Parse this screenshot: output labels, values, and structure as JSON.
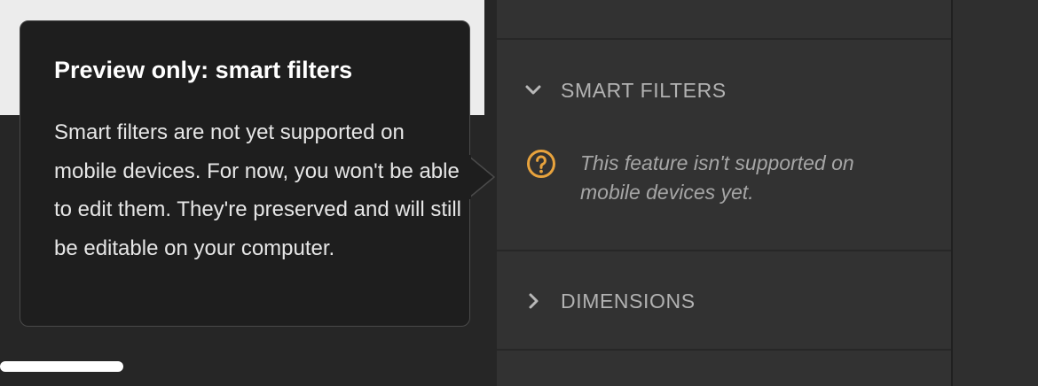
{
  "tooltip": {
    "title": "Preview only: smart filters",
    "body": "Smart filters are not yet supported on mobile devices. For now, you won't be able to edit them. They're preserved and will still be editable on your computer."
  },
  "panel": {
    "smart_filters": {
      "label": "SMART FILTERS",
      "expanded": true,
      "chevron_icon": "chevron-down-icon",
      "notice_icon": "question-circle-icon",
      "notice_text": "This feature isn't supported on mobile devices yet."
    },
    "dimensions": {
      "label": "DIMENSIONS",
      "expanded": false,
      "chevron_icon": "chevron-right-icon"
    }
  },
  "colors": {
    "notice_icon": "#e8a33d",
    "panel_bg": "#323232",
    "tooltip_bg": "#1e1e1e"
  }
}
